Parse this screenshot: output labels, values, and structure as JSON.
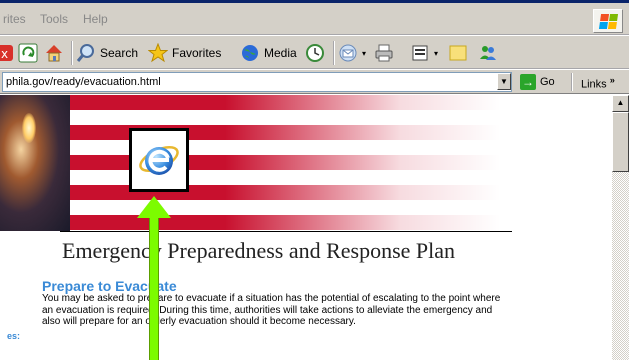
{
  "menu": {
    "favorites_partial": "rites",
    "tools": "Tools",
    "help": "Help"
  },
  "toolbar": {
    "search_label": "Search",
    "favorites_label": "Favorites",
    "media_label": "Media"
  },
  "address": {
    "url": "phila.gov/ready/evacuation.html",
    "go_label": "Go",
    "links_label": "Links",
    "links_chevron": "»"
  },
  "page": {
    "heading": "Emergency Preparedness and Response Plan",
    "subheading": "Prepare to Evacuate",
    "paragraph": "You may be asked to prepare to evacuate if a situation has the potential of escalating to the point where an evacuation is required. During this time, authorities will take actions to alleviate the emergency and also will prepare for an orderly evacuation should it become necessary.",
    "side_fragment": "es:"
  },
  "colors": {
    "flag_red": "#c8102e",
    "link_blue": "#3a8ad6",
    "arrow_green": "#7cfc00"
  }
}
